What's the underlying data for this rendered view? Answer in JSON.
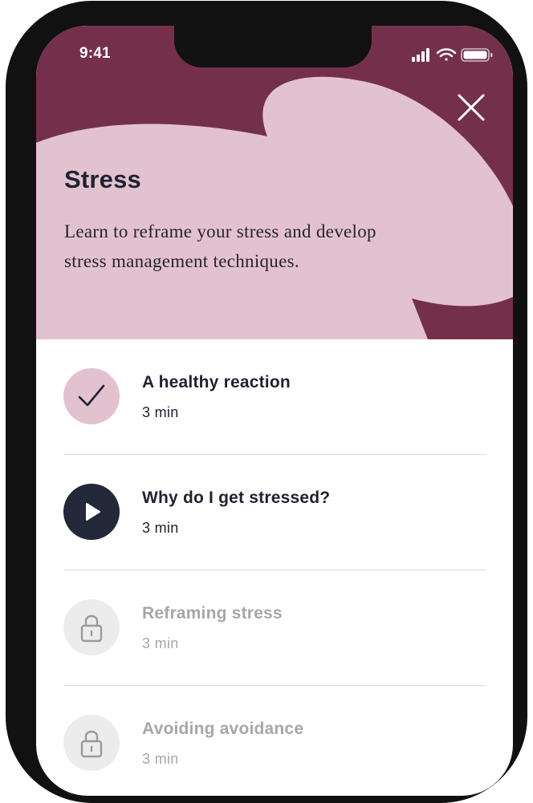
{
  "status_bar": {
    "time": "9:41"
  },
  "header": {
    "title": "Stress",
    "description": "Learn to reframe your stress and develop stress management techniques.",
    "close_icon": "close-icon"
  },
  "colors": {
    "header_background": "#74304b",
    "header_blob": "#e3c2cf",
    "completed_circle": "#e3c2cf",
    "play_circle": "#23283a",
    "locked_circle": "#ececec"
  },
  "lessons": [
    {
      "title": "A healthy reaction",
      "duration": "3 min",
      "state": "completed",
      "icon": "checkmark-icon"
    },
    {
      "title": "Why do I get stressed?",
      "duration": "3 min",
      "state": "available",
      "icon": "play-icon"
    },
    {
      "title": "Reframing stress",
      "duration": "3 min",
      "state": "locked",
      "icon": "lock-icon"
    },
    {
      "title": "Avoiding avoidance",
      "duration": "3 min",
      "state": "locked",
      "icon": "lock-icon"
    }
  ]
}
